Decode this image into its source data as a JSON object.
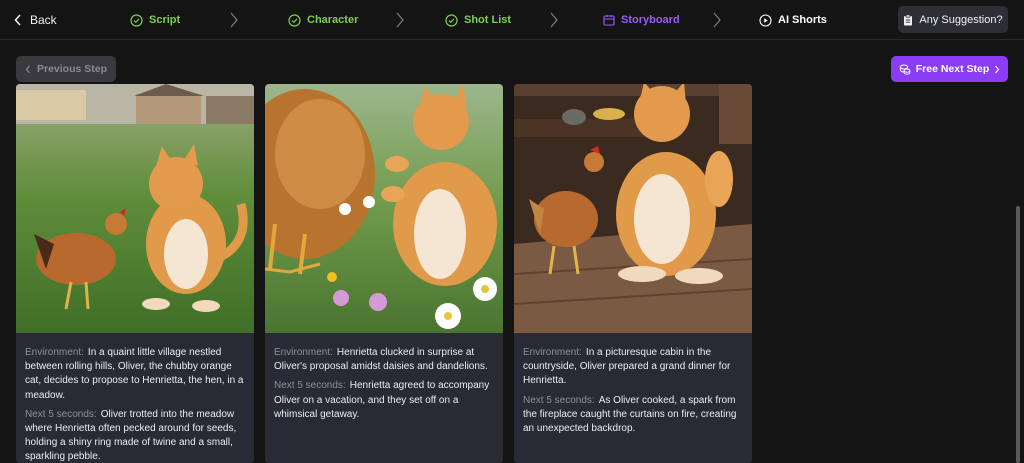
{
  "nav": {
    "back_label": "Back",
    "steps": [
      {
        "label": "Script",
        "state": "done"
      },
      {
        "label": "Character",
        "state": "done"
      },
      {
        "label": "Shot List",
        "state": "done"
      },
      {
        "label": "Storyboard",
        "state": "active"
      },
      {
        "label": "AI Shorts",
        "state": "pending"
      }
    ],
    "suggestion_label": "Any Suggestion?"
  },
  "actions": {
    "previous_label": "Previous Step",
    "next_label": "Free Next Step"
  },
  "labels": {
    "environment": "Environment:",
    "next5": "Next 5 seconds:"
  },
  "cards": [
    {
      "environment": "In a quaint little village nestled between rolling hills, Oliver, the chubby orange cat, decides to propose to Henrietta, the hen, in a meadow.",
      "next": "Oliver trotted into the meadow where Henrietta often pecked around for seeds, holding a shiny ring made of twine and a small, sparkling pebble."
    },
    {
      "environment": "Henrietta clucked in surprise at Oliver's proposal amidst daisies and dandelions.",
      "next": "Henrietta agreed to accompany Oliver on a vacation, and they set off on a whimsical getaway."
    },
    {
      "environment": "In a picturesque cabin in the countryside, Oliver prepared a grand dinner for Henrietta.",
      "next": "As Oliver cooked, a spark from the fireplace caught the curtains on fire, creating an unexpected backdrop."
    }
  ],
  "colors": {
    "done": "#7ecf4f",
    "active": "#9b5cf6",
    "accent_button": "#8b3df5",
    "card_bg": "#2a2a36"
  }
}
